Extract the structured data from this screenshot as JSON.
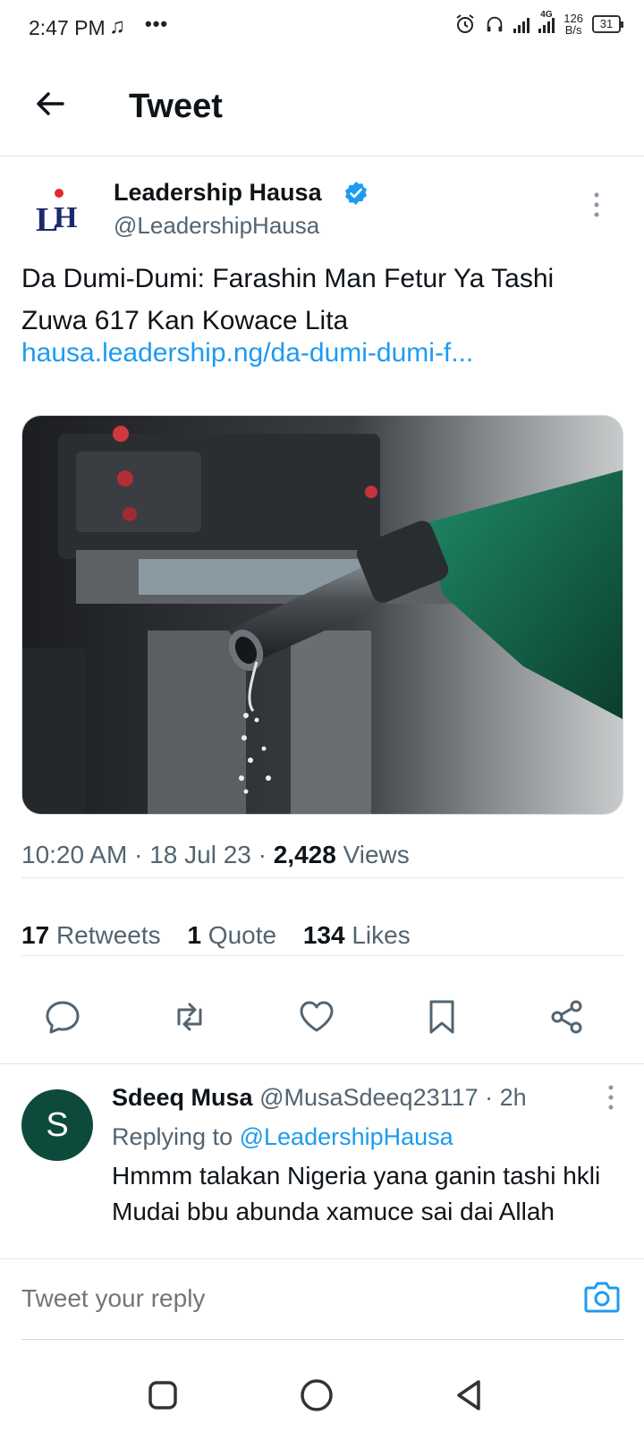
{
  "status_bar": {
    "time": "2:47 PM",
    "music_icon": "music-note-icon",
    "dots": "•••",
    "network": "4G",
    "speed_value": "126",
    "speed_unit": "B/s",
    "battery": "31"
  },
  "header": {
    "title": "Tweet",
    "back_icon": "arrow-left-icon"
  },
  "tweet": {
    "author_name": "Leadership Hausa",
    "author_handle": "@LeadershipHausa",
    "avatar_logo": "LH",
    "text": "Da Dumi-Dumi: Farashin Man Fetur Ya Tashi Zuwa 617 Kan Kowace Lita",
    "link": "hausa.leadership.ng/da-dumi-dumi-f...",
    "time": "10:20 AM",
    "date": "18 Jul 23",
    "views_count": "2,428",
    "views_label": "Views",
    "retweets_count": "17",
    "retweets_label": "Retweets",
    "quotes_count": "1",
    "quotes_label": "Quote",
    "likes_count": "134",
    "likes_label": "Likes"
  },
  "reply": {
    "avatar_letter": "S",
    "name": "Sdeeq Musa",
    "handle": "@MusaSdeeq23117",
    "age": "· 2h",
    "replying_label": "Replying to",
    "replying_to": "@LeadershipHausa",
    "text_line1": "Hmmm talakan Nigeria yana ganin tashi hkli",
    "text_line2": "Mudai bbu abunda xamuce sai dai Allah"
  },
  "composer": {
    "placeholder": "Tweet your reply"
  },
  "colors": {
    "accent": "#1d9bf0",
    "reply_avatar": "#0d4a3b",
    "secondary_text": "#536471"
  }
}
